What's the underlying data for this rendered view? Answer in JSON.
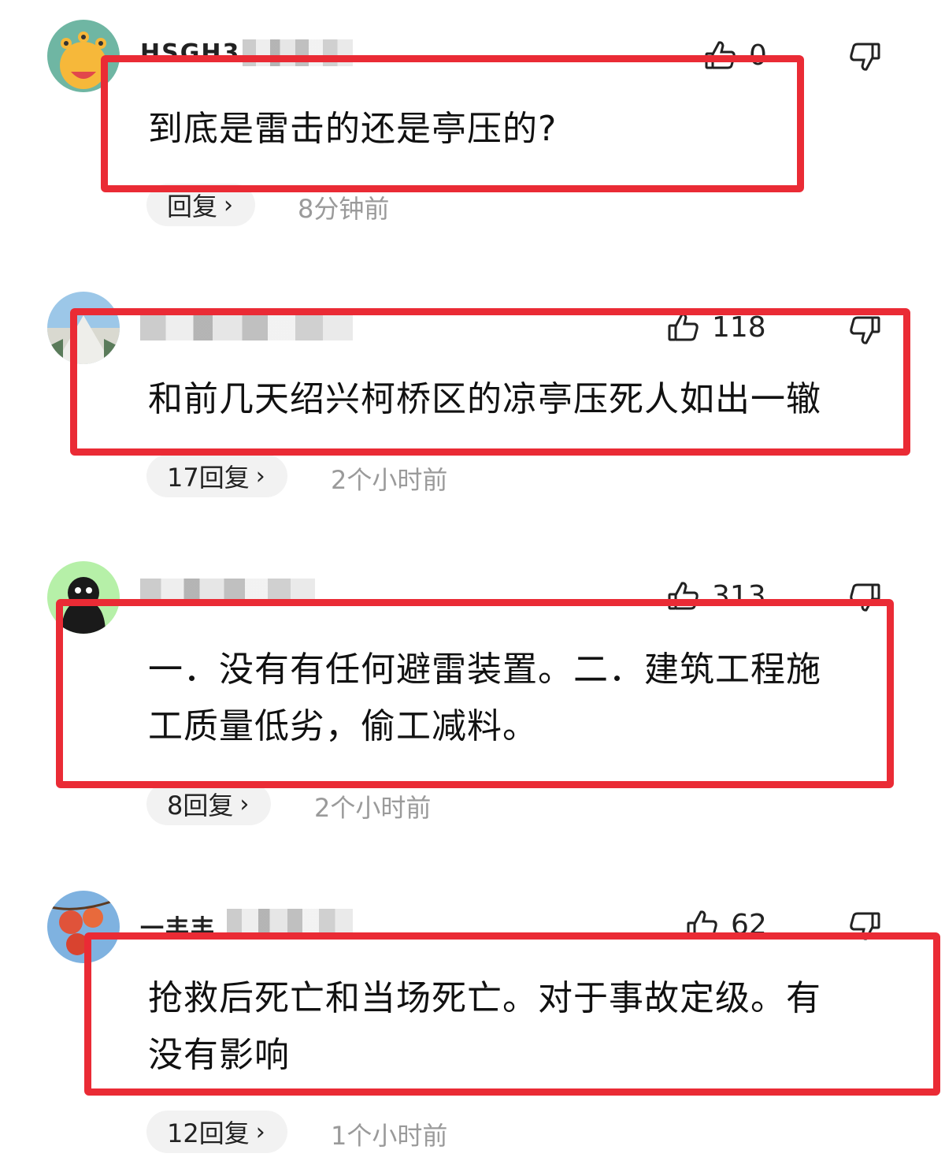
{
  "comments": [
    {
      "username": "HSGH3",
      "like_count": "0",
      "text": "到底是雷击的还是亭压的?",
      "reply_label": "回复",
      "time": "8分钟前"
    },
    {
      "username": "",
      "like_count": "118",
      "text": "和前几天绍兴柯桥区的凉亭压死人如出一辙",
      "reply_label": "17回复",
      "time": "2个小时前"
    },
    {
      "username": "",
      "like_count": "313",
      "text_line1": "一．没有有任何避雷装置。二．建筑工程施",
      "text_line2": "工质量低劣，偷工减料。",
      "reply_label": "8回复",
      "time": "2个小时前"
    },
    {
      "username": "一丰丰",
      "like_count": "62",
      "text_line1": "抢救后死亡和当场死亡。对于事故定级。有",
      "text_line2": "没有影响",
      "reply_label": "12回复",
      "time": "1个小时前"
    }
  ],
  "colors": {
    "highlight": "#ea2b35",
    "pill_bg": "#f2f2f2",
    "muted": "#9a9a9a"
  },
  "icons": [
    "thumbs-up-icon",
    "thumbs-down-icon",
    "chevron-right-icon"
  ]
}
